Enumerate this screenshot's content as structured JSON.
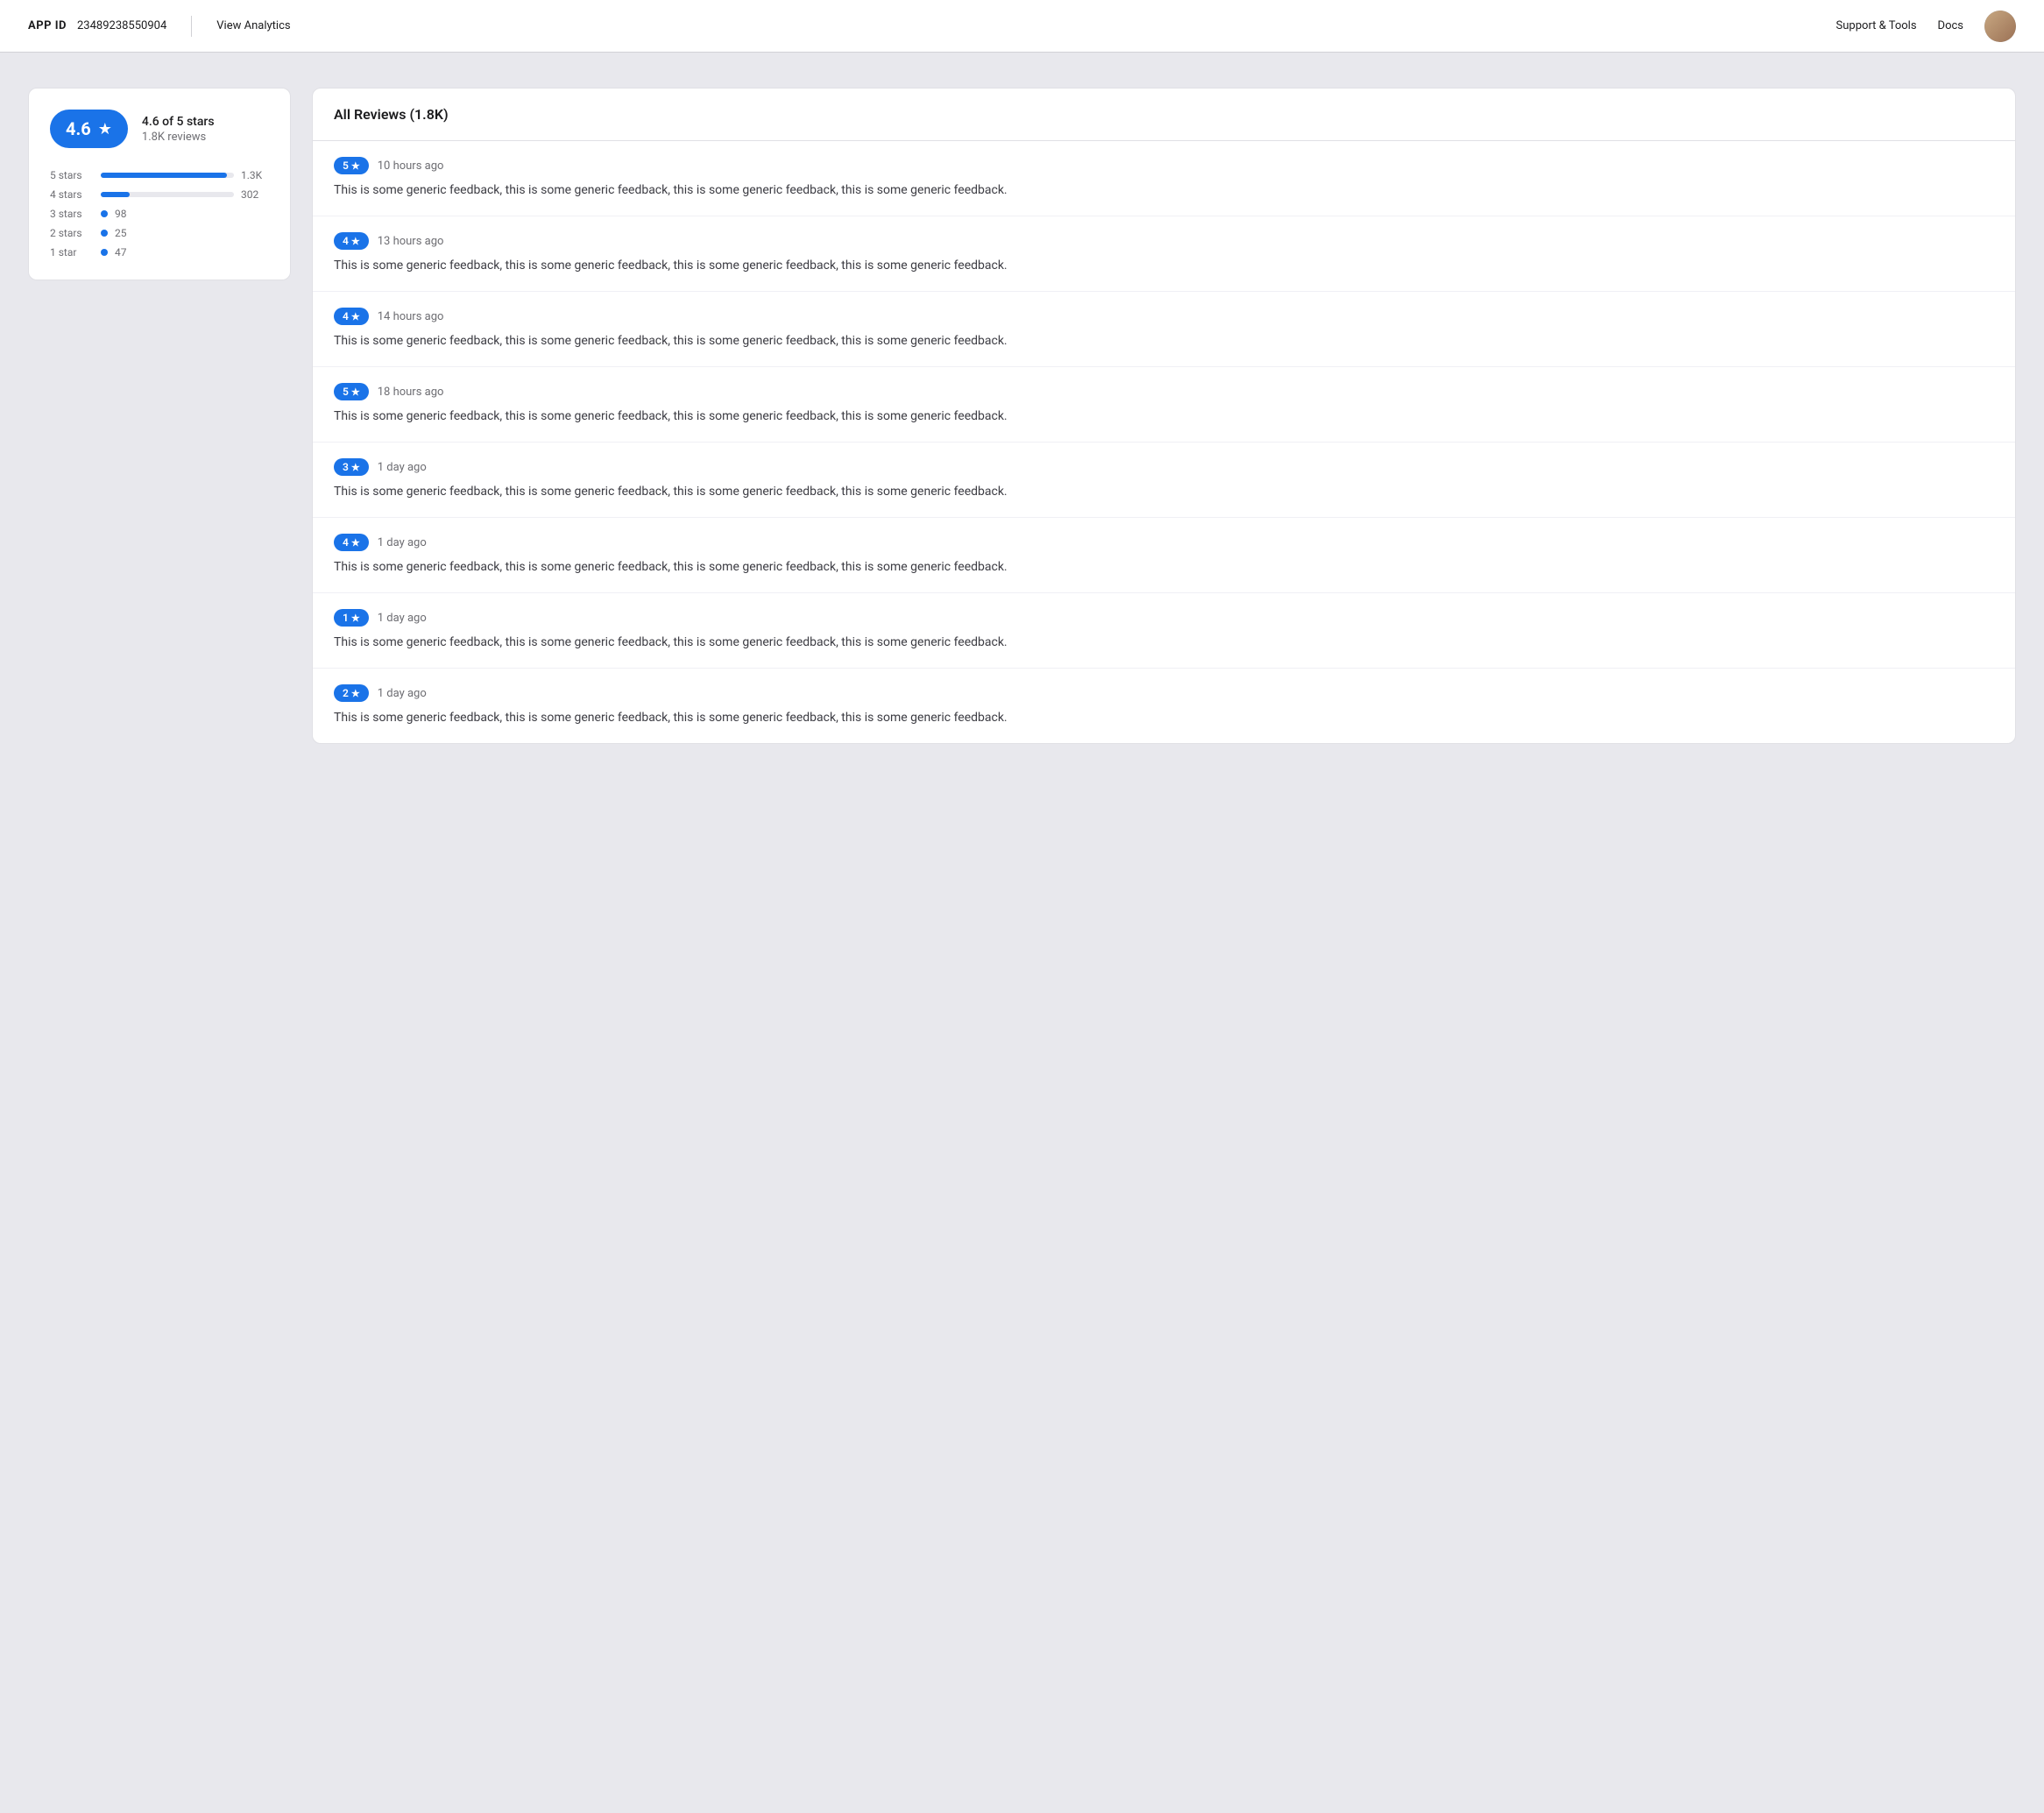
{
  "header": {
    "app_id_label": "APP ID",
    "app_id_value": "23489238550904",
    "view_analytics": "View Analytics",
    "support_tools": "Support & Tools",
    "docs": "Docs"
  },
  "rating": {
    "score": "4.6",
    "star_symbol": "★",
    "of_stars": "4.6 of 5 stars",
    "review_count": "1.8K reviews",
    "bars": [
      {
        "label": "5 stars",
        "width_pct": 95,
        "count": "1.3K",
        "type": "bar"
      },
      {
        "label": "4 stars",
        "width_pct": 22,
        "count": "302",
        "type": "bar"
      },
      {
        "label": "3 stars",
        "width_pct": 0,
        "count": "98",
        "type": "dot"
      },
      {
        "label": "2 stars",
        "width_pct": 0,
        "count": "25",
        "type": "dot"
      },
      {
        "label": "1 star",
        "width_pct": 0,
        "count": "47",
        "type": "dot"
      }
    ]
  },
  "reviews": {
    "title": "All Reviews (1.8K)",
    "items": [
      {
        "stars": 5,
        "time": "10 hours ago",
        "text": "This is some generic feedback, this is some generic feedback, this is some generic feedback, this is some generic feedback."
      },
      {
        "stars": 4,
        "time": "13 hours ago",
        "text": "This is some generic feedback, this is some generic feedback, this is some generic feedback, this is some generic feedback."
      },
      {
        "stars": 4,
        "time": "14 hours ago",
        "text": "This is some generic feedback, this is some generic feedback, this is some generic feedback, this is some generic feedback."
      },
      {
        "stars": 5,
        "time": "18 hours ago",
        "text": "This is some generic feedback, this is some generic feedback, this is some generic feedback, this is some generic feedback."
      },
      {
        "stars": 3,
        "time": "1 day ago",
        "text": "This is some generic feedback, this is some generic feedback, this is some generic feedback, this is some generic feedback."
      },
      {
        "stars": 4,
        "time": "1 day ago",
        "text": "This is some generic feedback, this is some generic feedback, this is some generic feedback, this is some generic feedback."
      },
      {
        "stars": 1,
        "time": "1 day ago",
        "text": "This is some generic feedback, this is some generic feedback, this is some generic feedback, this is some generic feedback."
      },
      {
        "stars": 2,
        "time": "1 day ago",
        "text": "This is some generic feedback, this is some generic feedback, this is some generic feedback, this is some generic feedback."
      }
    ]
  }
}
